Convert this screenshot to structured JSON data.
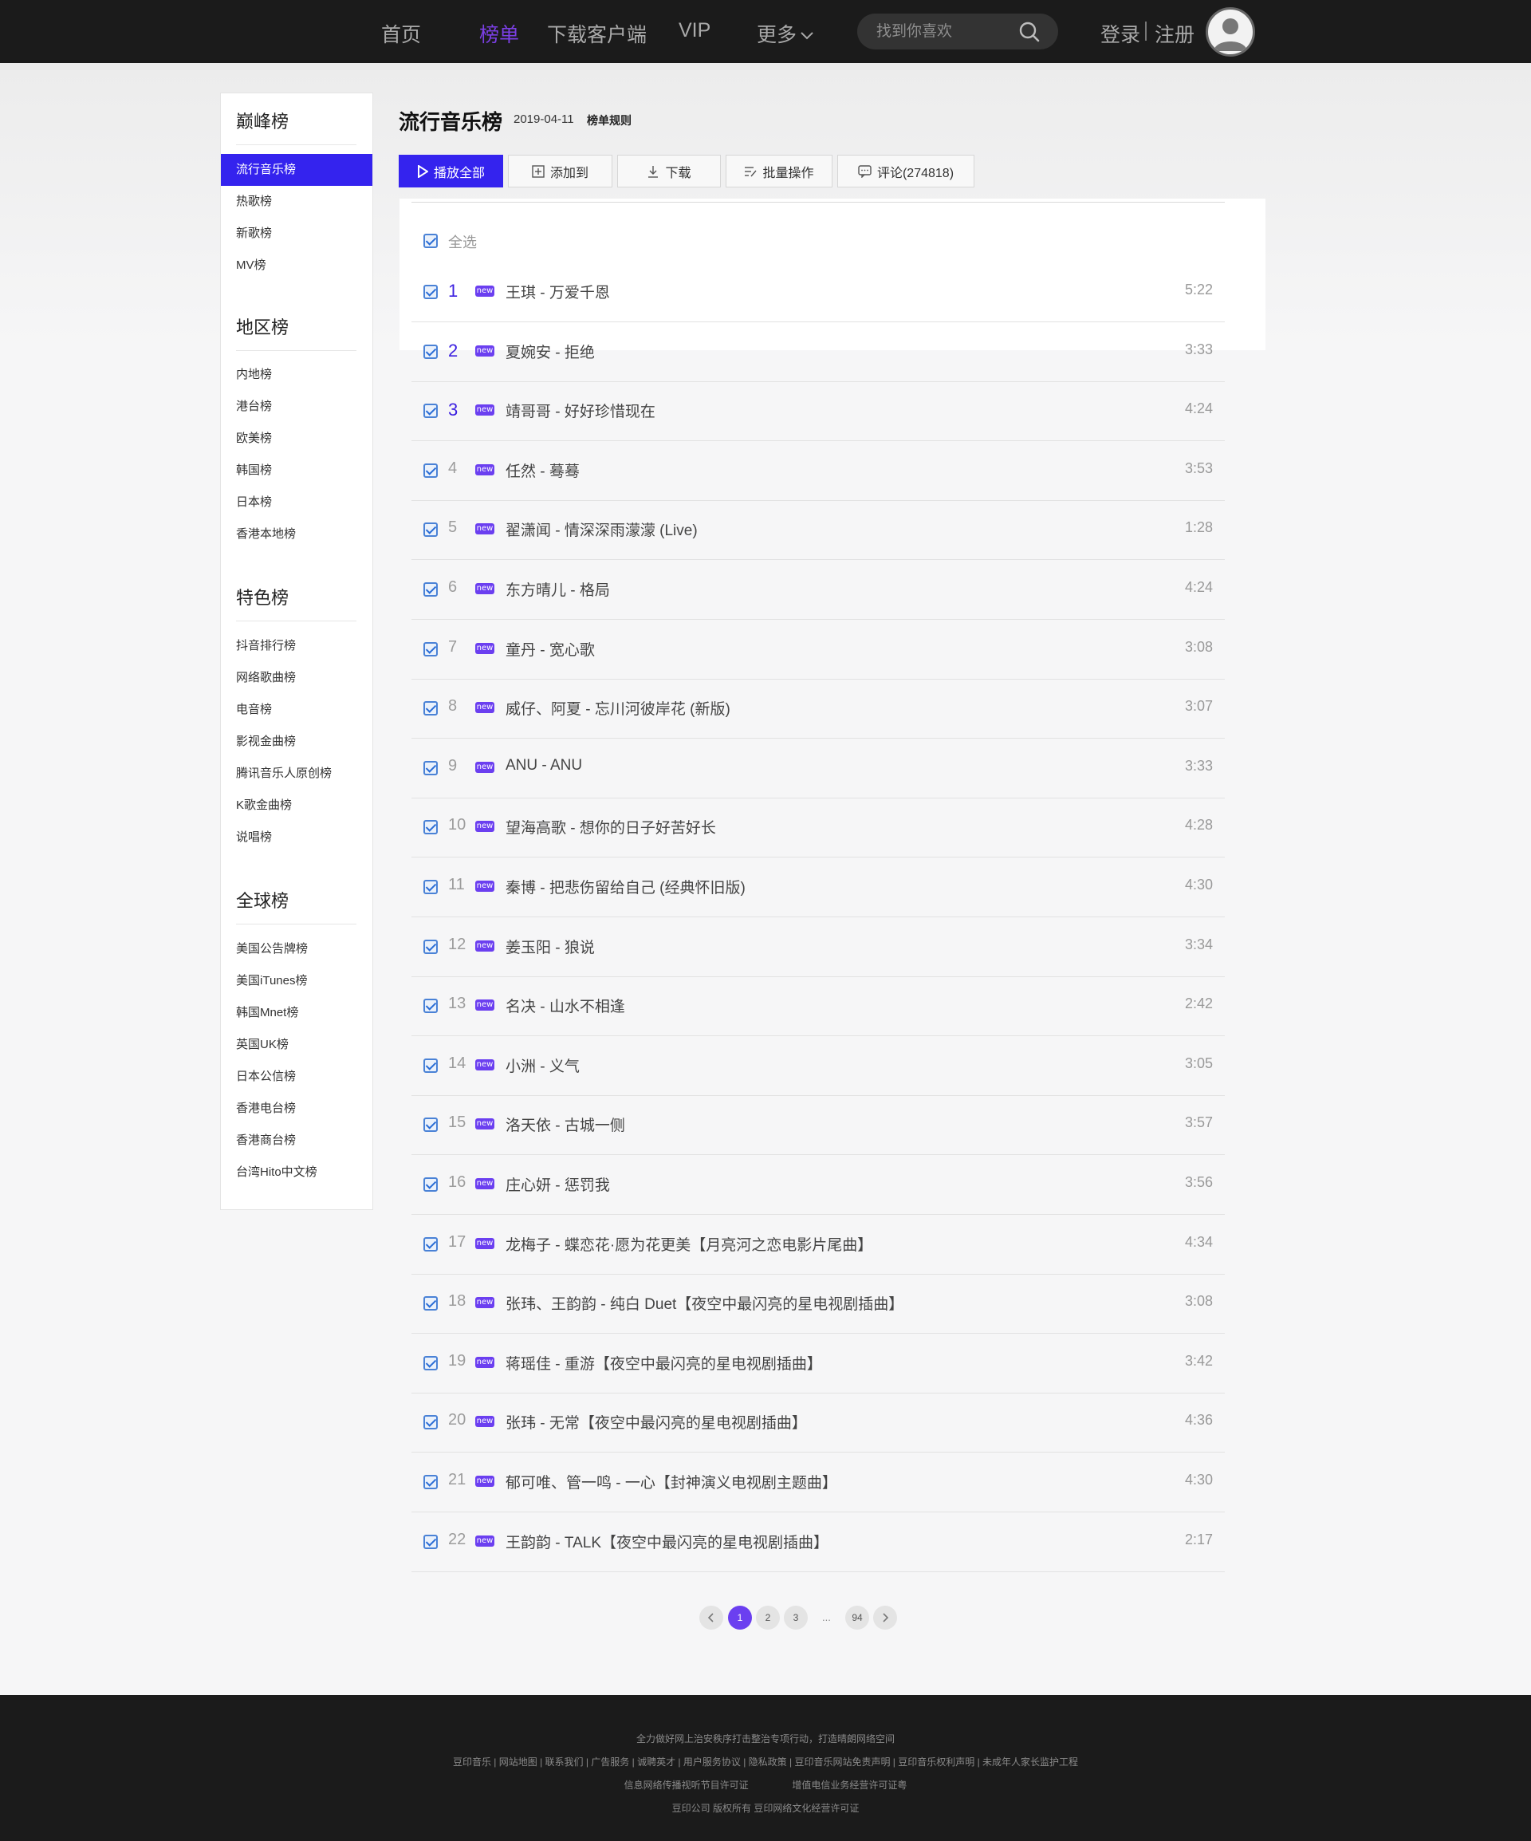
{
  "nav": {
    "items": [
      {
        "label": "首页"
      },
      {
        "label": "榜单"
      },
      {
        "label": "下载客户端"
      },
      {
        "label": "VIP"
      },
      {
        "label": "更多"
      }
    ],
    "search_placeholder": "找到你喜欢",
    "login": "登录",
    "register": "注册",
    "accent_color": "#7b3fe4"
  },
  "sidebar": {
    "sections": [
      {
        "title": "巅峰榜",
        "items": [
          "流行音乐榜",
          "热歌榜",
          "新歌榜",
          "MV榜"
        ]
      },
      {
        "title": "地区榜",
        "items": [
          "内地榜",
          "港台榜",
          "欧美榜",
          "韩国榜",
          "日本榜",
          "香港本地榜"
        ]
      },
      {
        "title": "特色榜",
        "items": [
          "抖音排行榜",
          "网络歌曲榜",
          "电音榜",
          "影视金曲榜",
          "腾讯音乐人原创榜",
          "K歌金曲榜",
          "说唱榜"
        ]
      },
      {
        "title": "全球榜",
        "items": [
          "美国公告牌榜",
          "美国iTunes榜",
          "韩国Mnet榜",
          "英国UK榜",
          "日本公信榜",
          "香港电台榜",
          "香港商台榜",
          "台湾Hito中文榜"
        ]
      }
    ],
    "active_item": "流行音乐榜",
    "active_color": "#3423ee"
  },
  "chart": {
    "title": "流行音乐榜",
    "date": "2019-04-11",
    "rule_link": "榜单规则"
  },
  "toolbar": {
    "play_all": "播放全部",
    "add_to": "添加到",
    "download": "下载",
    "batch": "批量操作",
    "comments": "评论(274818)"
  },
  "list": {
    "select_all": "全选",
    "new_badge": "new",
    "songs": [
      {
        "rank": "1",
        "title": "王琪 - 万爱千恩",
        "duration": "5:22"
      },
      {
        "rank": "2",
        "title": "夏婉安 - 拒绝",
        "duration": "3:33"
      },
      {
        "rank": "3",
        "title": "靖哥哥 - 好好珍惜现在",
        "duration": "4:24"
      },
      {
        "rank": "4",
        "title": "任然 - 蓦蓦",
        "duration": "3:53"
      },
      {
        "rank": "5",
        "title": "翟潇闻 - 情深深雨濛濛 (Live)",
        "duration": "1:28"
      },
      {
        "rank": "6",
        "title": "东方晴儿 - 格局",
        "duration": "4:24"
      },
      {
        "rank": "7",
        "title": "童丹 - 宽心歌",
        "duration": "3:08"
      },
      {
        "rank": "8",
        "title": "威仔、阿夏 - 忘川河彼岸花 (新版)",
        "duration": "3:07"
      },
      {
        "rank": "9",
        "title": "ANU - ANU",
        "duration": "3:33"
      },
      {
        "rank": "10",
        "title": "望海高歌 - 想你的日子好苦好长",
        "duration": "4:28"
      },
      {
        "rank": "11",
        "title": "秦博 - 把悲伤留给自己 (经典怀旧版)",
        "duration": "4:30"
      },
      {
        "rank": "12",
        "title": "姜玉阳 - 狼说",
        "duration": "3:34"
      },
      {
        "rank": "13",
        "title": "名决 - 山水不相逢",
        "duration": "2:42"
      },
      {
        "rank": "14",
        "title": "小洲 - 义气",
        "duration": "3:05"
      },
      {
        "rank": "15",
        "title": "洛天依 - 古城一侧",
        "duration": "3:57"
      },
      {
        "rank": "16",
        "title": "庄心妍 - 惩罚我",
        "duration": "3:56"
      },
      {
        "rank": "17",
        "title": "龙梅子 - 蝶恋花·愿为花更美【月亮河之恋电影片尾曲】",
        "duration": "4:34"
      },
      {
        "rank": "18",
        "title": "张玮、王韵韵 - 纯白 Duet【夜空中最闪亮的星电视剧插曲】",
        "duration": "3:08"
      },
      {
        "rank": "19",
        "title": "蒋瑶佳 - 重游【夜空中最闪亮的星电视剧插曲】",
        "duration": "3:42"
      },
      {
        "rank": "20",
        "title": "张玮 - 无常【夜空中最闪亮的星电视剧插曲】",
        "duration": "4:36"
      },
      {
        "rank": "21",
        "title": "郁可唯、管一鸣 - 一心【封神演义电视剧主题曲】",
        "duration": "4:30"
      },
      {
        "rank": "22",
        "title": "王韵韵 - TALK【夜空中最闪亮的星电视剧插曲】",
        "duration": "2:17"
      }
    ]
  },
  "pagination": {
    "pages": [
      "1",
      "2",
      "3"
    ],
    "ellipsis": "...",
    "last": "94",
    "current": "1"
  },
  "footer": {
    "line1": "全力做好网上治安秩序打击整治专项行动，打造晴朗网络空间",
    "line2": "豆印音乐 | 网站地图 | 联系我们 | 广告服务 | 诚聘英才 | 用户服务协议 | 隐私政策 | 豆印音乐网站免责声明 | 豆印音乐权利声明 | 未成年人家长监护工程",
    "line3a": "信息网络传播视听节目许可证",
    "line3b": "增值电信业务经营许可证粤",
    "line4": "豆印公司 版权所有 豆印网络文化经营许可证"
  }
}
